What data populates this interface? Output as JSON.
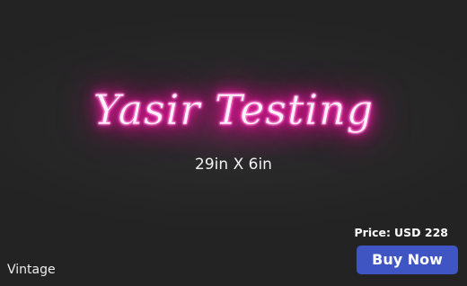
{
  "sign": {
    "text": "Yasir Testing",
    "size": "29in X 6in",
    "style": "Vintage",
    "neon_color": "#ff1aa8"
  },
  "pricing": {
    "label": "Price:",
    "amount": "USD 228"
  },
  "actions": {
    "buy_label": "Buy Now",
    "buy_color": "#3e55c3"
  },
  "background_color": "#262626"
}
